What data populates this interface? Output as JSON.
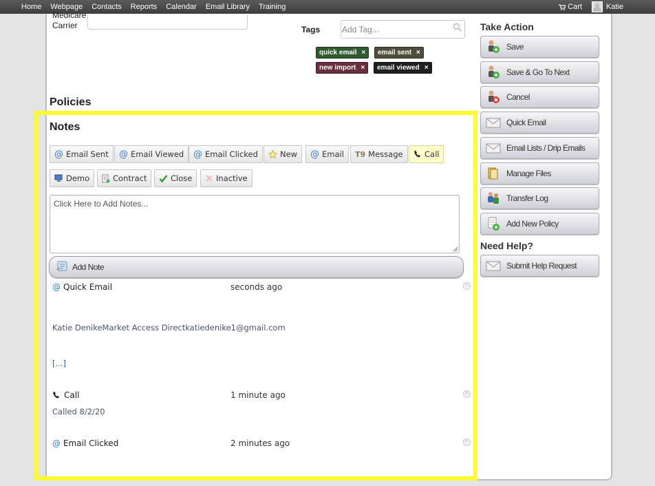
{
  "nav": {
    "items": [
      "Home",
      "Webpage",
      "Contacts",
      "Reports",
      "Calendar",
      "Email Library",
      "Training"
    ],
    "cart_label": "Cart",
    "user_name": "Katie"
  },
  "carrier": {
    "label_line1": "Medicare",
    "label_line2": "Carrier",
    "value": ""
  },
  "tags": {
    "label": "Tags",
    "placeholder": "Add Tag...",
    "items": [
      {
        "label": "quick email",
        "color": "#2f5a2f"
      },
      {
        "label": "email sent",
        "color": "#4e4e3a"
      },
      {
        "label": "new import",
        "color": "#6b2e3e"
      },
      {
        "label": "email viewed",
        "color": "#1f1f1f"
      }
    ],
    "remove_glyph": "×"
  },
  "policies": {
    "title": "Policies"
  },
  "notes": {
    "title": "Notes",
    "buttons": [
      {
        "label": "Email Sent",
        "icon": "at-icon"
      },
      {
        "label": "Email Viewed",
        "icon": "at-icon"
      },
      {
        "label": "Email Clicked",
        "icon": "at-icon"
      },
      {
        "label": "New",
        "icon": "star-icon"
      },
      {
        "label": "Email",
        "icon": "at-icon"
      },
      {
        "label": "Message",
        "icon": "message-icon"
      },
      {
        "label": "Call",
        "icon": "phone-icon",
        "active": true
      },
      {
        "label": "Demo",
        "icon": "monitor-icon"
      },
      {
        "label": "Contract",
        "icon": "document-icon"
      },
      {
        "label": "Close",
        "icon": "checkmark-icon"
      },
      {
        "label": "Inactive",
        "icon": "x-icon"
      }
    ],
    "textarea_placeholder": "Click Here to Add Notes...",
    "add_note_label": "Add Note",
    "entries": [
      {
        "type": "Quick Email",
        "icon": "at-icon",
        "time": "seconds ago",
        "body": "Katie DenikeMarket Access Directkatiedenike1@gmail.com",
        "more": "[...]"
      },
      {
        "type": "Call",
        "icon": "phone-icon",
        "time": "1 minute ago",
        "body": "Called 8/2/20"
      },
      {
        "type": "Email Clicked",
        "icon": "at-icon",
        "time": "2 minutes ago",
        "body": ""
      }
    ]
  },
  "sidebar": {
    "take_action_title": "Take Action",
    "actions": [
      {
        "label": "Save",
        "icon": "person-add-icon"
      },
      {
        "label": "Save & Go To Next",
        "icon": "person-add-icon"
      },
      {
        "label": "Cancel",
        "icon": "person-cancel-icon"
      },
      {
        "label": "Quick Email",
        "icon": "envelope-icon"
      },
      {
        "label": "Email Lists / Drip Emails",
        "icon": "envelope-icon"
      },
      {
        "label": "Manage Files",
        "icon": "folder-icon"
      },
      {
        "label": "Transfer Log",
        "icon": "people-icon"
      },
      {
        "label": "Add New Policy",
        "icon": "document-add-icon"
      }
    ],
    "help_title": "Need Help?",
    "help_button": {
      "label": "Submit Help Request",
      "icon": "envelope-icon"
    }
  }
}
